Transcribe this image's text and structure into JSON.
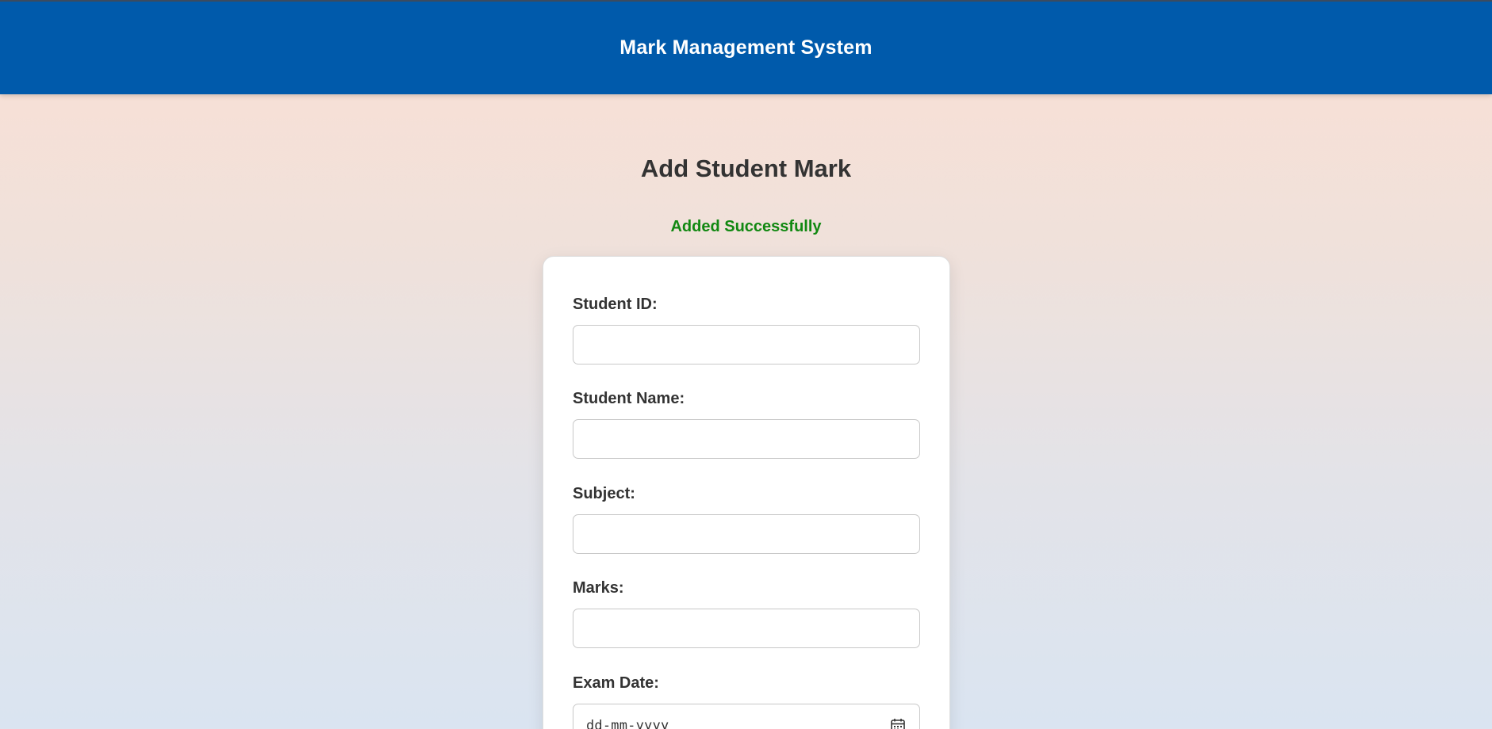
{
  "header": {
    "app_title": "Mark Management System"
  },
  "page": {
    "title": "Add Student Mark",
    "status_message": "Added Successfully"
  },
  "form": {
    "student_id": {
      "label": "Student ID:",
      "value": ""
    },
    "student_name": {
      "label": "Student Name:",
      "value": ""
    },
    "subject": {
      "label": "Subject:",
      "value": ""
    },
    "marks": {
      "label": "Marks:",
      "value": ""
    },
    "exam_date": {
      "label": "Exam Date:",
      "placeholder": "dd-mm-yyyy",
      "icon": "calendar-icon"
    }
  },
  "colors": {
    "header_bg": "#005aab",
    "success": "#118811",
    "text": "#333333"
  }
}
